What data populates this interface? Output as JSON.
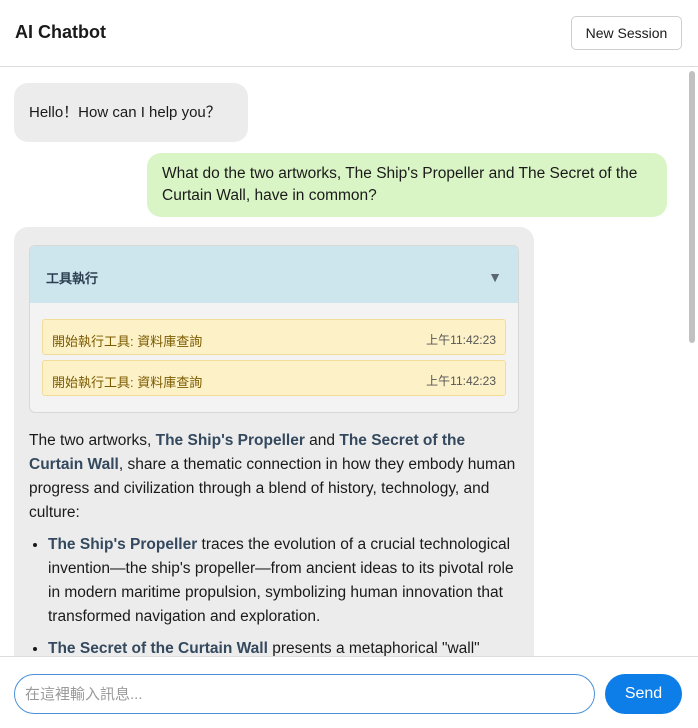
{
  "header": {
    "title": "AI Chatbot",
    "new_session_label": "New Session"
  },
  "messages": {
    "greeting": "Hello！How can I help you？",
    "user_question": "What do the two artworks, The Ship's Propeller and The Secret of the Curtain Wall, have in common?",
    "tool_panel": {
      "title": "工具執行",
      "toggle_icon": "▼",
      "logs": [
        {
          "text": "開始執行工具: 資料庫查詢",
          "time": "上午11:42:23"
        },
        {
          "text": "開始執行工具: 資料庫查詢",
          "time": "上午11:42:23"
        }
      ]
    },
    "answer": {
      "intro_1": "The two artworks, ",
      "artwork_1": "The Ship's Propeller",
      "intro_2": " and ",
      "artwork_2": "The Secret of the Curtain Wall",
      "intro_3": ", share a thematic connection in how they embody human progress and civilization through a blend of history, technology, and culture:",
      "bullets": [
        {
          "title": "The Ship's Propeller",
          "text": " traces the evolution of a crucial technological invention—the ship's propeller—from ancient ideas to its pivotal role in modern maritime propulsion, symbolizing human innovation that transformed navigation and exploration."
        },
        {
          "title": "The Secret of the Curtain Wall",
          "text": " presents a metaphorical \"wall\""
        }
      ]
    }
  },
  "composer": {
    "placeholder": "在這裡輸入訊息...",
    "send_label": "Send"
  },
  "colors": {
    "user_bubble": "#d9f5c5",
    "bot_bubble": "#ececec",
    "tool_header": "#cde6ee",
    "log_item": "#fdf1c7",
    "send_button": "#0d7de8"
  }
}
